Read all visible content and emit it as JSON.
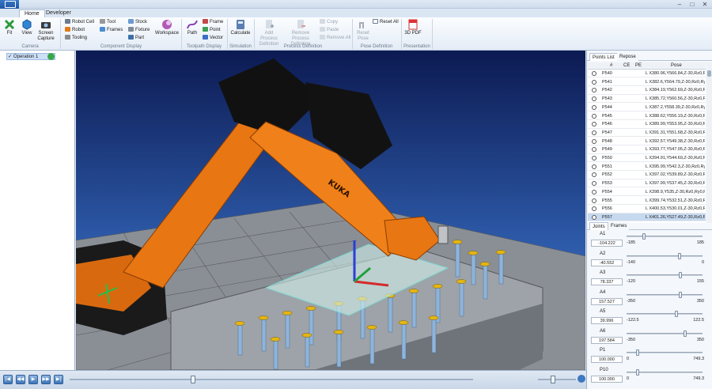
{
  "tabs": [
    "Home",
    "Developer"
  ],
  "ribbon": {
    "camera": {
      "fit": "Fit",
      "view": "View",
      "screen_capture": "Screen Capture",
      "group": "Camera"
    },
    "component_display": {
      "robot_cell": "Robot Cell",
      "robot": "Robot",
      "tooling": "Tooling",
      "tool": "Tool",
      "frames": "Frames",
      "stock": "Stock",
      "fixture": "Fixture",
      "part": "Part",
      "workspace": "Workspace",
      "group": "Component Display"
    },
    "toolpath_display": {
      "path": "Path",
      "frame": "Frame",
      "point": "Point",
      "vector": "Vector",
      "group": "Toolpath Display"
    },
    "simulation": {
      "calculate": "Calculate",
      "group": "Simulation"
    },
    "process_definition": {
      "add": "Add Process Definition",
      "remove": "Remove Process Definition",
      "copy": "Copy",
      "paste": "Paste",
      "remove_all": "Remove All",
      "group": "Process Definition"
    },
    "pose_definition": {
      "reset_pose": "Reset Pose",
      "reset_all": "Reset All",
      "group": "Pose Definition"
    },
    "presentation": {
      "pdf": "3D PDF",
      "group": "Presentation"
    }
  },
  "operations": [
    {
      "label": "Operation 1"
    }
  ],
  "viewport": {
    "robot_brand": "KUKA"
  },
  "points_panel": {
    "tabs": [
      "Points List",
      "Repose"
    ],
    "columns": [
      "#",
      "CE",
      "PE",
      "Pose"
    ],
    "rows": [
      {
        "name": "P540",
        "pose": "L X380.96,Y566.84,Z-30,Rz0,Ry"
      },
      {
        "name": "P541",
        "pose": "L X382.6,Y564.79,Z-30,Rz0,Ry0,R"
      },
      {
        "name": "P542",
        "pose": "L X384.19,Y562.69,Z-30,Rz0,Ry"
      },
      {
        "name": "P543",
        "pose": "L X385.72,Y560.56,Z-30,Rz0,Ry"
      },
      {
        "name": "P544",
        "pose": "L X387.2,Y558.39,Z-30,Rz0,Ry0,R"
      },
      {
        "name": "P545",
        "pose": "L X388.62,Y556.19,Z-30,Rz0,Ry"
      },
      {
        "name": "P546",
        "pose": "L X389.99,Y553.95,Z-30,Rz0,Ry"
      },
      {
        "name": "P547",
        "pose": "L X391.31,Y551.68,Z-30,Rz0,Ry"
      },
      {
        "name": "P548",
        "pose": "L X392.57,Y549.38,Z-30,Rz0,Ry"
      },
      {
        "name": "P549",
        "pose": "L X393.77,Y547.05,Z-30,Rz0,Ry"
      },
      {
        "name": "P550",
        "pose": "L X394.91,Y544.69,Z-30,Rz0,Ry"
      },
      {
        "name": "P551",
        "pose": "L X395.99,Y542.3,Z-30,Rz0,Ry0,R"
      },
      {
        "name": "P552",
        "pose": "L X397.02,Y539.89,Z-30,Rz0,Ry"
      },
      {
        "name": "P553",
        "pose": "L X397.99,Y537.45,Z-30,Rz0,Ry"
      },
      {
        "name": "P554",
        "pose": "L X398.9,Y535,Z-30,Rz0,Ry0,R"
      },
      {
        "name": "P555",
        "pose": "L X399.74,Y532.51,Z-30,Rz0,Ry"
      },
      {
        "name": "P556",
        "pose": "L X400.53,Y530.01,Z-30,Rz0,Ry"
      },
      {
        "name": "P557",
        "pose": "L X401.26,Y527.49,Z-30,Rz0,Ry"
      }
    ],
    "selected": "P557"
  },
  "joints_panel": {
    "tabs": [
      "Joints",
      "Frames"
    ],
    "joints": [
      {
        "label": "A1",
        "value": "-104.222",
        "min": "-185",
        "max": "185",
        "fraction": 0.22
      },
      {
        "label": "A2",
        "value": "-40.552",
        "min": "-140",
        "max": "0",
        "fraction": 0.71
      },
      {
        "label": "A3",
        "value": "78.337",
        "min": "-120",
        "max": "155",
        "fraction": 0.72
      },
      {
        "label": "A4",
        "value": "157.527",
        "min": "-350",
        "max": "350",
        "fraction": 0.72
      },
      {
        "label": "A5",
        "value": "39.996",
        "min": "-122.5",
        "max": "122.5",
        "fraction": 0.66
      },
      {
        "label": "A6",
        "value": "197.584",
        "min": "-350",
        "max": "350",
        "fraction": 0.78
      },
      {
        "label": "P1",
        "value": "100.000",
        "min": "0",
        "max": "749.3",
        "fraction": 0.13
      },
      {
        "label": "P10",
        "value": "100.000",
        "min": "0",
        "max": "749.3",
        "fraction": 0.13
      }
    ]
  },
  "timeline": {
    "progress": 0.3
  }
}
